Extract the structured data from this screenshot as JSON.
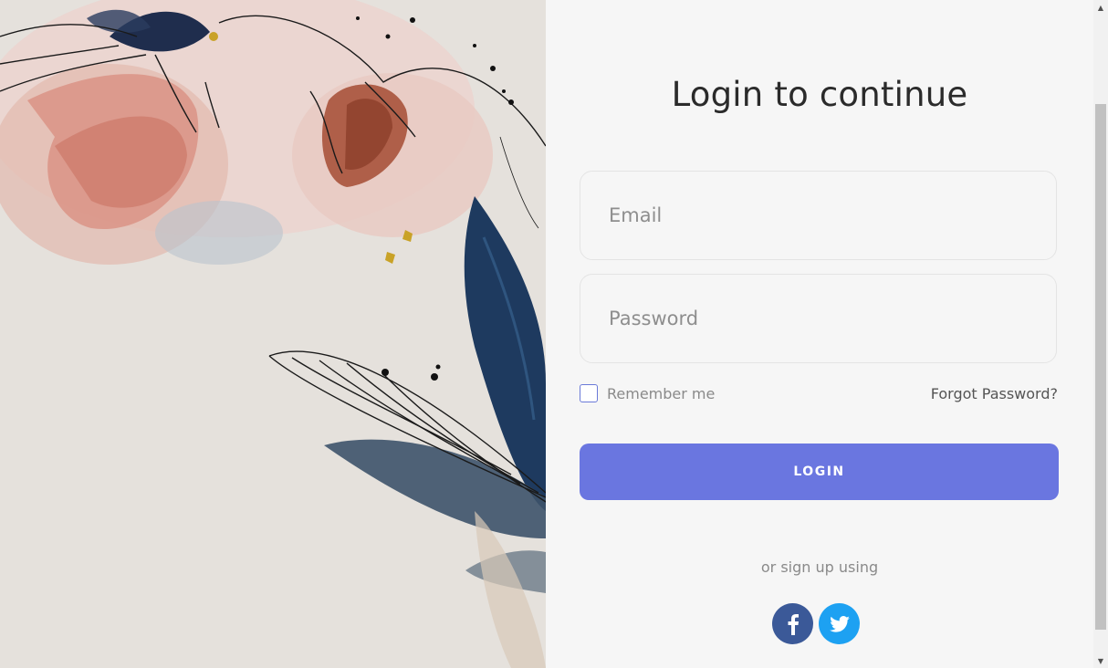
{
  "login": {
    "title": "Login to continue",
    "email_placeholder": "Email",
    "password_placeholder": "Password",
    "remember_label": "Remember me",
    "forgot_label": "Forgot Password?",
    "login_button": "LOGIN",
    "signup_text": "or sign up using"
  },
  "social": [
    {
      "name": "facebook",
      "icon": "facebook-icon",
      "color": "#3b5998"
    },
    {
      "name": "twitter",
      "icon": "twitter-icon",
      "color": "#1da1f2"
    }
  ],
  "colors": {
    "accent": "#6a76e0",
    "background": "#f6f6f6"
  }
}
